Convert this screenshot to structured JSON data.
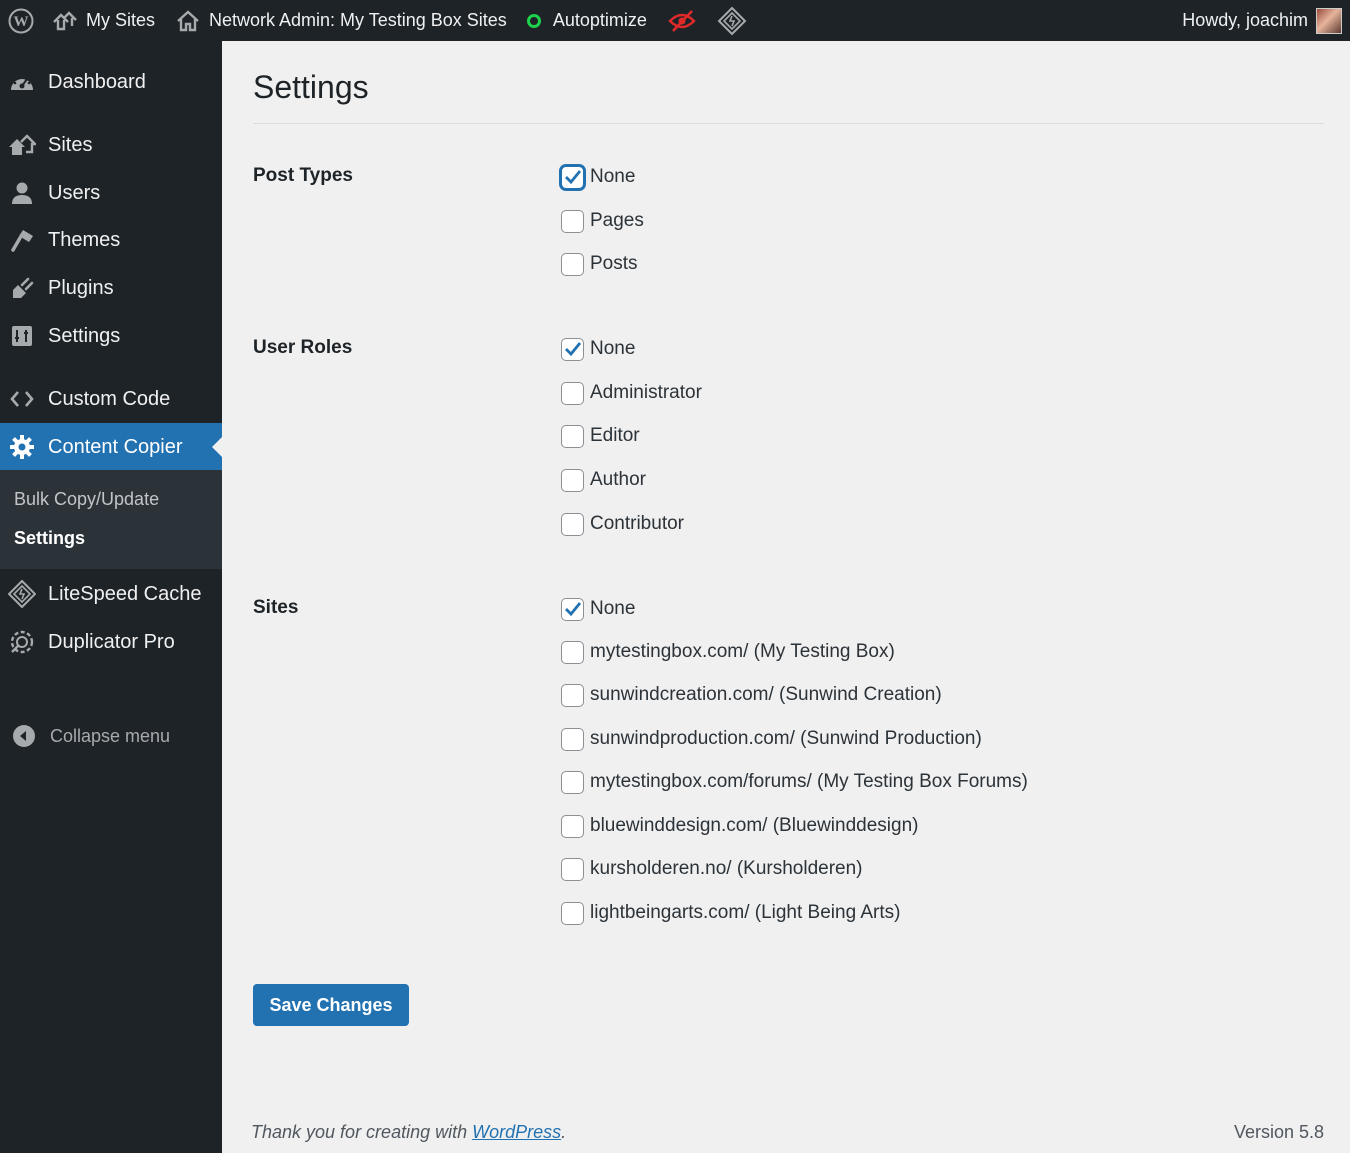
{
  "adminbar": {
    "my_sites": "My Sites",
    "network_admin": "Network Admin: My Testing Box Sites",
    "autoptimize": "Autoptimize",
    "howdy": "Howdy, joachim",
    "autoptimize_status_color": "#1ed14b",
    "hidden_icon_color": "#e02a2a"
  },
  "sidebar": {
    "items": [
      {
        "label": "Dashboard",
        "icon": "dashboard-icon"
      },
      {
        "label": "Sites",
        "icon": "sites-icon"
      },
      {
        "label": "Users",
        "icon": "users-icon"
      },
      {
        "label": "Themes",
        "icon": "themes-icon"
      },
      {
        "label": "Plugins",
        "icon": "plugins-icon"
      },
      {
        "label": "Settings",
        "icon": "settings-icon"
      },
      {
        "label": "Custom Code",
        "icon": "code-icon"
      },
      {
        "label": "Content Copier",
        "icon": "gear-icon",
        "current": true
      },
      {
        "label": "LiteSpeed Cache",
        "icon": "litespeed-icon"
      },
      {
        "label": "Duplicator Pro",
        "icon": "duplicator-icon"
      }
    ],
    "submenu": [
      {
        "label": "Bulk Copy/Update"
      },
      {
        "label": "Settings",
        "active": true
      }
    ],
    "collapse": "Collapse menu"
  },
  "page": {
    "title": "Settings",
    "post_types": {
      "label": "Post Types",
      "options": [
        {
          "label": "None",
          "checked": true
        },
        {
          "label": "Pages",
          "checked": false
        },
        {
          "label": "Posts",
          "checked": false
        }
      ]
    },
    "user_roles": {
      "label": "User Roles",
      "options": [
        {
          "label": "None",
          "checked": true
        },
        {
          "label": "Administrator",
          "checked": false
        },
        {
          "label": "Editor",
          "checked": false
        },
        {
          "label": "Author",
          "checked": false
        },
        {
          "label": "Contributor",
          "checked": false
        }
      ]
    },
    "sites": {
      "label": "Sites",
      "options": [
        {
          "label": "None",
          "checked": true
        },
        {
          "label": "mytestingbox.com/ (My Testing Box)",
          "checked": false
        },
        {
          "label": "sunwindcreation.com/ (Sunwind Creation)",
          "checked": false
        },
        {
          "label": "sunwindproduction.com/ (Sunwind Production)",
          "checked": false
        },
        {
          "label": "mytestingbox.com/forums/ (My Testing Box Forums)",
          "checked": false
        },
        {
          "label": "bluewinddesign.com/ (Bluewinddesign)",
          "checked": false
        },
        {
          "label": "kursholderen.no/ (Kursholderen)",
          "checked": false
        },
        {
          "label": "lightbeingarts.com/ (Light Being Arts)",
          "checked": false
        }
      ]
    },
    "save_label": "Save Changes"
  },
  "footer": {
    "thanks_prefix": "Thank you for creating with ",
    "link": "WordPress",
    "thanks_suffix": ".",
    "version": "Version 5.8"
  },
  "colors": {
    "accent": "#2271b1",
    "sidebar_bg": "#1d2327",
    "page_bg": "#f0f0f1"
  }
}
